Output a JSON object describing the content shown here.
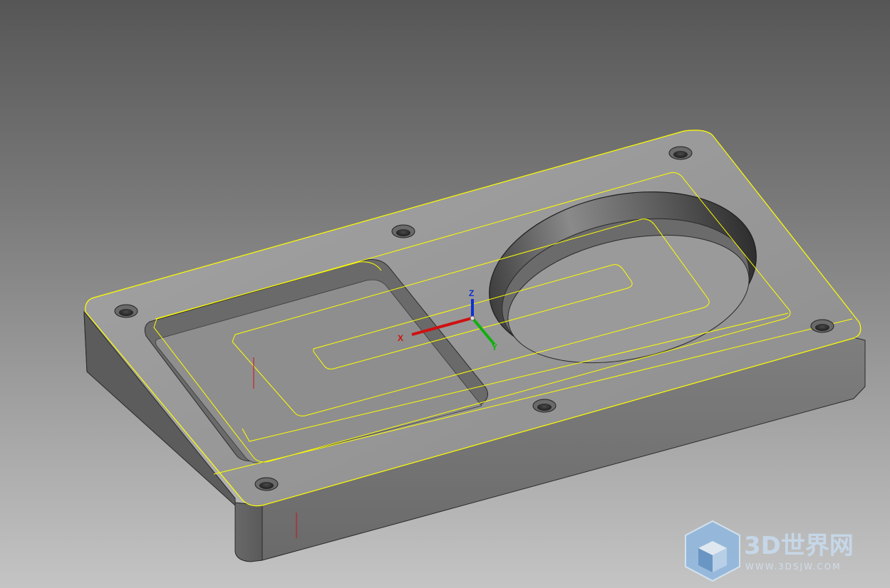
{
  "viewport": {
    "background_top": "#565656",
    "background_bottom": "#c4c4c4",
    "part_face_color": "#9a9a9a",
    "edge_highlight_color": "#ffff00"
  },
  "triad": {
    "x_label": "X",
    "y_label": "Y",
    "z_label": "Z",
    "x_color": "#d01010",
    "y_color": "#10b010",
    "z_color": "#1030d0"
  },
  "watermark": {
    "brand": "3D世界网",
    "url": "WWW.3DSJW.COM",
    "icon": "cube-logo-icon",
    "color": "#c8dcf0"
  }
}
